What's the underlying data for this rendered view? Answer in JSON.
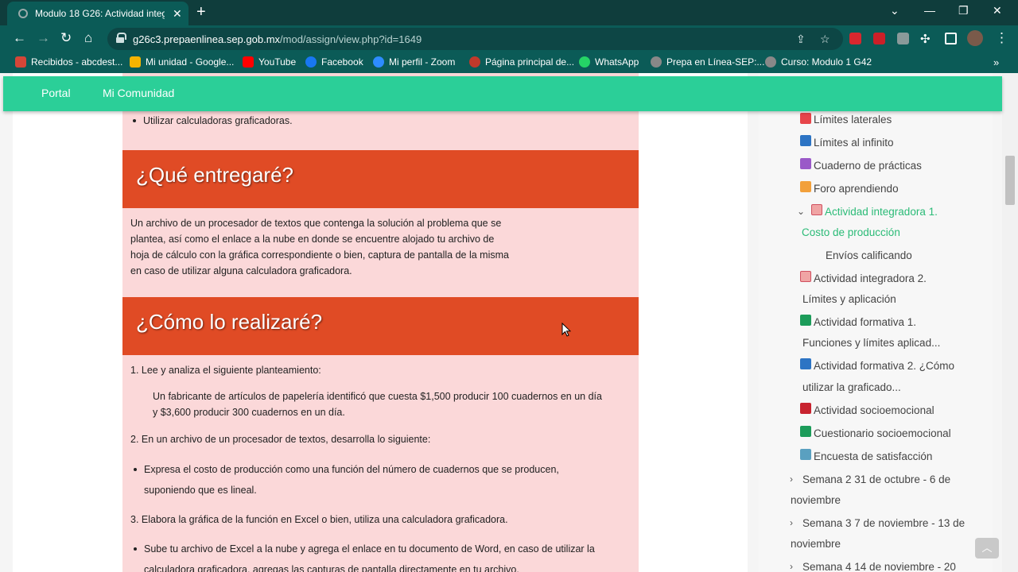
{
  "browser": {
    "tab_title": "Modulo 18 G26: Actividad integr",
    "tab_close": "✕",
    "new_tab": "+",
    "url_host": "g26c3.prepaenlinea.sep.gob.mx",
    "url_path": "/mod/assign/view.php?id=1649",
    "bookmarks": [
      {
        "label": "Recibidos - abcdest...",
        "color": "#d44638"
      },
      {
        "label": "Mi unidad - Google...",
        "color": "#f4b400"
      },
      {
        "label": "YouTube",
        "color": "#ff0000"
      },
      {
        "label": "Facebook",
        "color": "#1877f2"
      },
      {
        "label": "Mi perfil - Zoom",
        "color": "#2d8cff"
      },
      {
        "label": "Página principal de...",
        "color": "#c0392b"
      },
      {
        "label": "WhatsApp",
        "color": "#25d366"
      },
      {
        "label": "Prepa en Línea-SEP:...",
        "color": "#888888"
      },
      {
        "label": "Curso: Modulo 1 G42",
        "color": "#888888"
      }
    ],
    "more_bookmarks": "»"
  },
  "nav": {
    "portal": "Portal",
    "comunidad": "Mi Comunidad"
  },
  "main": {
    "top_bullet": "Utilizar calculadoras graficadoras.",
    "entregare_heading": "¿Qué entregaré?",
    "entregare_lines": [
      "Un archivo de un procesador de textos que contenga la solución al problema que se",
      "plantea, así como el enlace a la nube en donde se encuentre alojado tu archivo de",
      "hoja de cálculo con la gráfica correspondiente o bien, captura de pantalla de la misma",
      "en caso de utilizar alguna calculadora graficadora."
    ],
    "realizare_heading": "¿Cómo lo realizaré?",
    "step1": "1. Lee y analiza el siguiente planteamiento:",
    "problem_lines": [
      "Un fabricante de artículos de papelería identificó que cuesta $1,500 producir 100 cuadernos en un día",
      "y $3,600 producir 300 cuadernos en un día."
    ],
    "step2": "2. En un archivo de un procesador de textos, desarrolla lo siguiente:",
    "bullet2_lines": [
      "Expresa el costo de producción como una función del número de cuadernos que se producen,",
      "suponiendo que es lineal."
    ],
    "step3": "3. Elabora la gráfica de la función en Excel o bien, utiliza una calculadora graficadora.",
    "bullet3_lines": [
      "Sube tu archivo de Excel a la nube y agrega el enlace en tu documento de Word, en caso de utilizar la",
      "calculadora graficadora, agregas las capturas de pantalla directamente en tu archivo."
    ]
  },
  "drawer": {
    "items": [
      {
        "label": "Límites laterales",
        "icon": "red"
      },
      {
        "label": "Límites al infinito",
        "icon": "blue"
      },
      {
        "label": "Cuaderno de prácticas",
        "icon": "purple"
      },
      {
        "label": "Foro aprendiendo",
        "icon": "orange"
      }
    ],
    "active_line1": "Actividad integradora 1.",
    "active_line2": "Costo de producción",
    "sub_item": "Envíos calificando",
    "items2": [
      {
        "line1": "Actividad integradora 2.",
        "line2": "Límites y aplicación",
        "icon": "pink"
      },
      {
        "line1": "Actividad formativa 1.",
        "line2": "Funciones y límites aplicad...",
        "icon": "green"
      },
      {
        "line1": "Actividad formativa 2. ¿Cómo",
        "line2": "utilizar la graficado...",
        "icon": "blue"
      }
    ],
    "items3": [
      {
        "label": "Actividad socioemocional",
        "icon": "crimson"
      },
      {
        "label": "Cuestionario socioemocional",
        "icon": "green"
      },
      {
        "label": "Encuesta de satisfacción",
        "icon": "teal"
      }
    ],
    "weeks": [
      {
        "line1": "Semana 2 31 de octubre - 6 de",
        "line2": "noviembre"
      },
      {
        "line1": "Semana 3 7 de noviembre - 13 de",
        "line2": "noviembre"
      },
      {
        "line1": "Semana 4 14 de noviembre - 20",
        "line2": ""
      }
    ]
  }
}
